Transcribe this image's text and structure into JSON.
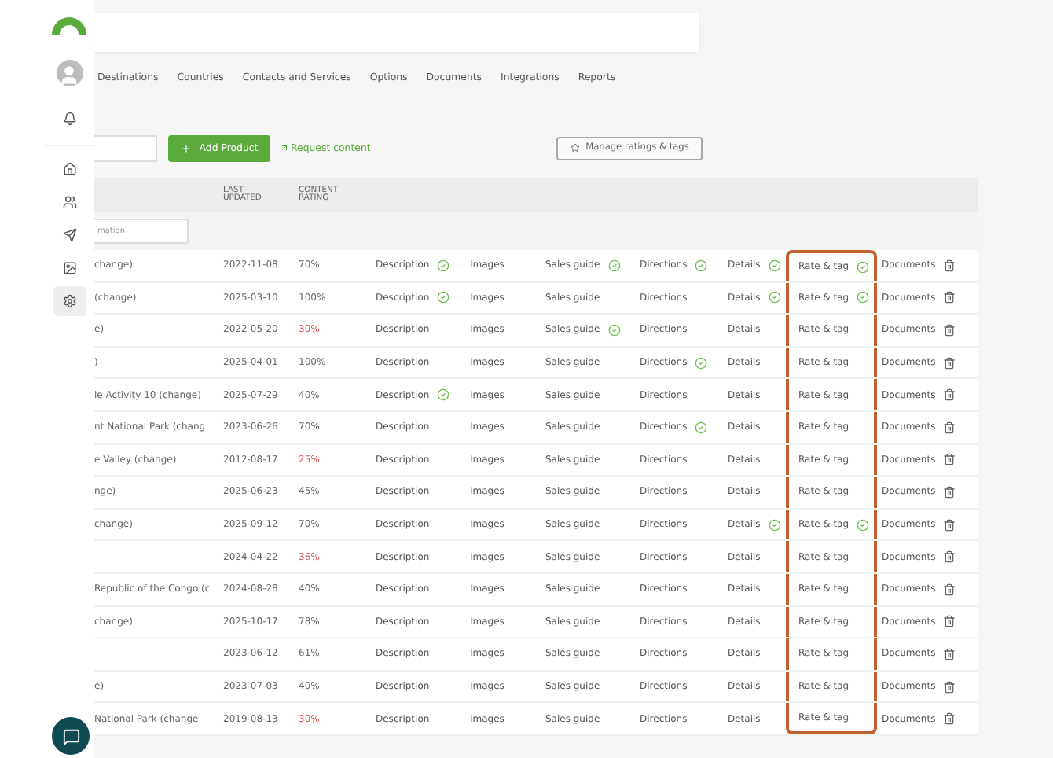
{
  "sidebar": {
    "items": [
      {
        "kind": "home",
        "selected": false
      },
      {
        "kind": "users",
        "selected": false
      },
      {
        "kind": "send",
        "selected": false
      },
      {
        "kind": "image",
        "selected": false
      },
      {
        "kind": "settings",
        "selected": true
      }
    ]
  },
  "nav": [
    "Destinations",
    "Countries",
    "Contacts and Services",
    "Options",
    "Documents",
    "Integrations",
    "Reports"
  ],
  "toolbar": {
    "add_button": "Add Product",
    "request_link": "Request content",
    "manage_button": "Manage ratings & tags"
  },
  "table": {
    "headers": [
      "LAST UPDATED",
      "CONTENT RATING"
    ],
    "filter_placeholder": "mation",
    "rows": [
      {
        "name": "change)",
        "updated": "2022-11-08",
        "rating": "70%",
        "low": false,
        "cells": [
          {
            "kind": "status",
            "label": "Description",
            "checked": true,
            "highlighted": false
          },
          {
            "kind": "status",
            "label": "Images",
            "checked": false,
            "highlighted": false
          },
          {
            "kind": "status",
            "label": "Sales guide",
            "checked": true,
            "highlighted": false
          },
          {
            "kind": "status",
            "label": "Directions",
            "checked": true,
            "highlighted": false
          },
          {
            "kind": "status",
            "label": "Details",
            "checked": true,
            "highlighted": false
          },
          {
            "kind": "status",
            "label": "Rate & tag",
            "checked": true,
            "highlighted": true
          },
          {
            "kind": "file",
            "label": "Documents",
            "highlighted": false
          }
        ]
      },
      {
        "name": "(change)",
        "updated": "2025-03-10",
        "rating": "100%",
        "low": false,
        "cells": [
          {
            "kind": "status",
            "label": "Description",
            "checked": true,
            "highlighted": false
          },
          {
            "kind": "status",
            "label": "Images",
            "checked": false,
            "highlighted": false
          },
          {
            "kind": "status",
            "label": "Sales guide",
            "checked": false,
            "highlighted": false
          },
          {
            "kind": "status",
            "label": "Directions",
            "checked": false,
            "highlighted": false
          },
          {
            "kind": "status",
            "label": "Details",
            "checked": true,
            "highlighted": false
          },
          {
            "kind": "status",
            "label": "Rate & tag",
            "checked": true,
            "highlighted": true
          },
          {
            "kind": "file",
            "label": "Documents",
            "highlighted": false
          }
        ]
      },
      {
        "name": "e)",
        "updated": "2022-05-20",
        "rating": "30%",
        "low": true,
        "cells": [
          {
            "kind": "status",
            "label": "Description",
            "checked": false,
            "highlighted": false
          },
          {
            "kind": "status",
            "label": "Images",
            "checked": false,
            "highlighted": false
          },
          {
            "kind": "status",
            "label": "Sales guide",
            "checked": true,
            "highlighted": false
          },
          {
            "kind": "status",
            "label": "Directions",
            "checked": false,
            "highlighted": false
          },
          {
            "kind": "status",
            "label": "Details",
            "checked": false,
            "highlighted": false
          },
          {
            "kind": "status",
            "label": "Rate & tag",
            "checked": false,
            "highlighted": true
          },
          {
            "kind": "file",
            "label": "Documents",
            "highlighted": false
          }
        ]
      },
      {
        "name": ")",
        "updated": "2025-04-01",
        "rating": "100%",
        "low": false,
        "cells": [
          {
            "kind": "status",
            "label": "Description",
            "checked": false,
            "highlighted": false
          },
          {
            "kind": "status",
            "label": "Images",
            "checked": false,
            "highlighted": false
          },
          {
            "kind": "status",
            "label": "Sales guide",
            "checked": false,
            "highlighted": false
          },
          {
            "kind": "status",
            "label": "Directions",
            "checked": true,
            "highlighted": false
          },
          {
            "kind": "status",
            "label": "Details",
            "checked": false,
            "highlighted": false
          },
          {
            "kind": "status",
            "label": "Rate & tag",
            "checked": false,
            "highlighted": true
          },
          {
            "kind": "file",
            "label": "Documents",
            "highlighted": false
          }
        ]
      },
      {
        "name": "le Activity 10 (change)",
        "updated": "2025-07-29",
        "rating": "40%",
        "low": false,
        "cells": [
          {
            "kind": "status",
            "label": "Description",
            "checked": true,
            "highlighted": false
          },
          {
            "kind": "status",
            "label": "Images",
            "checked": false,
            "highlighted": false
          },
          {
            "kind": "status",
            "label": "Sales guide",
            "checked": false,
            "highlighted": false
          },
          {
            "kind": "status",
            "label": "Directions",
            "checked": false,
            "highlighted": false
          },
          {
            "kind": "status",
            "label": "Details",
            "checked": false,
            "highlighted": false
          },
          {
            "kind": "status",
            "label": "Rate & tag",
            "checked": false,
            "highlighted": true
          },
          {
            "kind": "file",
            "label": "Documents",
            "highlighted": false
          }
        ]
      },
      {
        "name": "nt National Park (chang",
        "updated": "2023-06-26",
        "rating": "70%",
        "low": false,
        "cells": [
          {
            "kind": "status",
            "label": "Description",
            "checked": false,
            "highlighted": false
          },
          {
            "kind": "status",
            "label": "Images",
            "checked": false,
            "highlighted": false
          },
          {
            "kind": "status",
            "label": "Sales guide",
            "checked": false,
            "highlighted": false
          },
          {
            "kind": "status",
            "label": "Directions",
            "checked": true,
            "highlighted": false
          },
          {
            "kind": "status",
            "label": "Details",
            "checked": false,
            "highlighted": false
          },
          {
            "kind": "status",
            "label": "Rate & tag",
            "checked": false,
            "highlighted": true
          },
          {
            "kind": "file",
            "label": "Documents",
            "highlighted": false
          }
        ]
      },
      {
        "name": "e Valley (change)",
        "updated": "2012-08-17",
        "rating": "25%",
        "low": true,
        "cells": [
          {
            "kind": "status",
            "label": "Description",
            "checked": false,
            "highlighted": false
          },
          {
            "kind": "status",
            "label": "Images",
            "checked": false,
            "highlighted": false
          },
          {
            "kind": "status",
            "label": "Sales guide",
            "checked": false,
            "highlighted": false
          },
          {
            "kind": "status",
            "label": "Directions",
            "checked": false,
            "highlighted": false
          },
          {
            "kind": "status",
            "label": "Details",
            "checked": false,
            "highlighted": false
          },
          {
            "kind": "status",
            "label": "Rate & tag",
            "checked": false,
            "highlighted": true
          },
          {
            "kind": "file",
            "label": "Documents",
            "highlighted": false
          }
        ]
      },
      {
        "name": "nge)",
        "updated": "2025-06-23",
        "rating": "45%",
        "low": false,
        "cells": [
          {
            "kind": "status",
            "label": "Description",
            "checked": false,
            "highlighted": false
          },
          {
            "kind": "status",
            "label": "Images",
            "checked": false,
            "highlighted": false
          },
          {
            "kind": "status",
            "label": "Sales guide",
            "checked": false,
            "highlighted": false
          },
          {
            "kind": "status",
            "label": "Directions",
            "checked": false,
            "highlighted": false
          },
          {
            "kind": "status",
            "label": "Details",
            "checked": false,
            "highlighted": false
          },
          {
            "kind": "status",
            "label": "Rate & tag",
            "checked": false,
            "highlighted": true
          },
          {
            "kind": "file",
            "label": "Documents",
            "highlighted": false
          }
        ]
      },
      {
        "name": "change)",
        "updated": "2025-09-12",
        "rating": "70%",
        "low": false,
        "cells": [
          {
            "kind": "status",
            "label": "Description",
            "checked": false,
            "highlighted": false
          },
          {
            "kind": "status",
            "label": "Images",
            "checked": false,
            "highlighted": false
          },
          {
            "kind": "status",
            "label": "Sales guide",
            "checked": false,
            "highlighted": false
          },
          {
            "kind": "status",
            "label": "Directions",
            "checked": false,
            "highlighted": false
          },
          {
            "kind": "status",
            "label": "Details",
            "checked": true,
            "highlighted": false
          },
          {
            "kind": "status",
            "label": "Rate & tag",
            "checked": true,
            "highlighted": true
          },
          {
            "kind": "file",
            "label": "Documents",
            "highlighted": false
          }
        ]
      },
      {
        "name": "",
        "updated": "2024-04-22",
        "rating": "36%",
        "low": true,
        "cells": [
          {
            "kind": "status",
            "label": "Description",
            "checked": false,
            "highlighted": false
          },
          {
            "kind": "status",
            "label": "Images",
            "checked": false,
            "highlighted": false
          },
          {
            "kind": "status",
            "label": "Sales guide",
            "checked": false,
            "highlighted": false
          },
          {
            "kind": "status",
            "label": "Directions",
            "checked": false,
            "highlighted": false
          },
          {
            "kind": "status",
            "label": "Details",
            "checked": false,
            "highlighted": false
          },
          {
            "kind": "status",
            "label": "Rate & tag",
            "checked": false,
            "highlighted": true
          },
          {
            "kind": "file",
            "label": "Documents",
            "highlighted": false
          }
        ]
      },
      {
        "name": "Republic of the Congo (c",
        "updated": "2024-08-28",
        "rating": "40%",
        "low": false,
        "cells": [
          {
            "kind": "status",
            "label": "Description",
            "checked": false,
            "highlighted": false
          },
          {
            "kind": "status",
            "label": "Images",
            "checked": false,
            "highlighted": false
          },
          {
            "kind": "status",
            "label": "Sales guide",
            "checked": false,
            "highlighted": false
          },
          {
            "kind": "status",
            "label": "Directions",
            "checked": false,
            "highlighted": false
          },
          {
            "kind": "status",
            "label": "Details",
            "checked": false,
            "highlighted": false
          },
          {
            "kind": "status",
            "label": "Rate & tag",
            "checked": false,
            "highlighted": true
          },
          {
            "kind": "file",
            "label": "Documents",
            "highlighted": false
          }
        ]
      },
      {
        "name": "change)",
        "updated": "2025-10-17",
        "rating": "78%",
        "low": false,
        "cells": [
          {
            "kind": "status",
            "label": "Description",
            "checked": false,
            "highlighted": false
          },
          {
            "kind": "status",
            "label": "Images",
            "checked": false,
            "highlighted": false
          },
          {
            "kind": "status",
            "label": "Sales guide",
            "checked": false,
            "highlighted": false
          },
          {
            "kind": "status",
            "label": "Directions",
            "checked": false,
            "highlighted": false
          },
          {
            "kind": "status",
            "label": "Details",
            "checked": false,
            "highlighted": false
          },
          {
            "kind": "status",
            "label": "Rate & tag",
            "checked": false,
            "highlighted": true
          },
          {
            "kind": "file",
            "label": "Documents",
            "highlighted": false
          }
        ]
      },
      {
        "name": "",
        "updated": "2023-06-12",
        "rating": "61%",
        "low": false,
        "cells": [
          {
            "kind": "status",
            "label": "Description",
            "checked": false,
            "highlighted": false
          },
          {
            "kind": "status",
            "label": "Images",
            "checked": false,
            "highlighted": false
          },
          {
            "kind": "status",
            "label": "Sales guide",
            "checked": false,
            "highlighted": false
          },
          {
            "kind": "status",
            "label": "Directions",
            "checked": false,
            "highlighted": false
          },
          {
            "kind": "status",
            "label": "Details",
            "checked": false,
            "highlighted": false
          },
          {
            "kind": "status",
            "label": "Rate & tag",
            "checked": false,
            "highlighted": true
          },
          {
            "kind": "file",
            "label": "Documents",
            "highlighted": false
          }
        ]
      },
      {
        "name": "e)",
        "updated": "2023-07-03",
        "rating": "40%",
        "low": false,
        "cells": [
          {
            "kind": "status",
            "label": "Description",
            "checked": false,
            "highlighted": false
          },
          {
            "kind": "status",
            "label": "Images",
            "checked": false,
            "highlighted": false
          },
          {
            "kind": "status",
            "label": "Sales guide",
            "checked": false,
            "highlighted": false
          },
          {
            "kind": "status",
            "label": "Directions",
            "checked": false,
            "highlighted": false
          },
          {
            "kind": "status",
            "label": "Details",
            "checked": false,
            "highlighted": false
          },
          {
            "kind": "status",
            "label": "Rate & tag",
            "checked": false,
            "highlighted": true
          },
          {
            "kind": "file",
            "label": "Documents",
            "highlighted": false
          }
        ]
      },
      {
        "name": "National Park (change",
        "updated": "2019-08-13",
        "rating": "30%",
        "low": true,
        "cells": [
          {
            "kind": "status",
            "label": "Description",
            "checked": false,
            "highlighted": false
          },
          {
            "kind": "status",
            "label": "Images",
            "checked": false,
            "highlighted": false
          },
          {
            "kind": "status",
            "label": "Sales guide",
            "checked": false,
            "highlighted": false
          },
          {
            "kind": "status",
            "label": "Directions",
            "checked": false,
            "highlighted": false
          },
          {
            "kind": "status",
            "label": "Details",
            "checked": false,
            "highlighted": false
          },
          {
            "kind": "status",
            "label": "Rate & tag",
            "checked": false,
            "highlighted": true
          },
          {
            "kind": "file",
            "label": "Documents",
            "highlighted": false
          }
        ]
      }
    ]
  }
}
